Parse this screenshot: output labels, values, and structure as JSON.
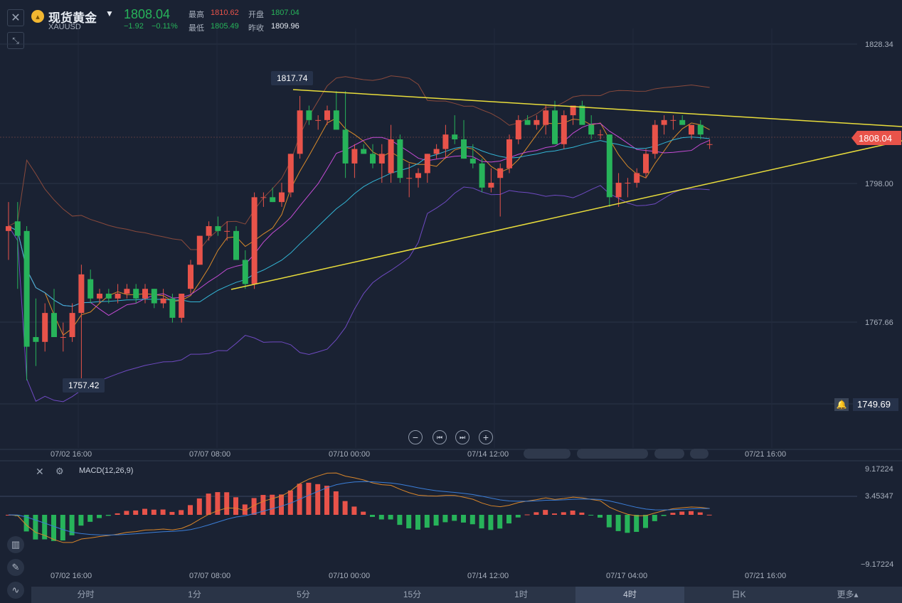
{
  "header": {
    "title": "现货黄金",
    "symbol": "XAUUSD",
    "price": "1808.04",
    "change": "−1.92",
    "change_pct": "−0.11%",
    "high_label": "最高",
    "high_value": "1810.62",
    "open_label": "开盘",
    "open_value": "1807.04",
    "low_label": "最低",
    "low_value": "1805.49",
    "prev_label": "昨收",
    "prev_value": "1809.96"
  },
  "price_axis": {
    "ticks": [
      "1828.34",
      "1798.00",
      "1767.66"
    ],
    "current_price": "1808.04",
    "alert_price": "1749.69"
  },
  "annotations": {
    "high": "1817.74",
    "low": "1757.42"
  },
  "time_axis": [
    "07/02 16:00",
    "07/07 08:00",
    "07/10 00:00",
    "07/14 12:00",
    "07/17 04:00",
    "07/21 16:00"
  ],
  "macd": {
    "label": "MACD(12,26,9)",
    "ticks": [
      "9.17224",
      "3.45347",
      "−9.17224"
    ]
  },
  "tabs": [
    "分时",
    "1分",
    "5分",
    "15分",
    "1时",
    "4时",
    "日K",
    "更多▴"
  ],
  "active_tab": "4时",
  "colors": {
    "up": "#e8534a",
    "down": "#27b35a",
    "trend": "#e9dd3b",
    "bg": "#1a2233"
  },
  "chart_data": {
    "type": "candlestick",
    "ylim": [
      1745,
      1832
    ],
    "candles": [
      [
        1790,
        1796,
        1784,
        1791
      ],
      [
        1792,
        1796,
        1778,
        1789
      ],
      [
        1790,
        1791,
        1759,
        1766
      ],
      [
        1768,
        1776,
        1762,
        1767
      ],
      [
        1767,
        1775,
        1765,
        1773
      ],
      [
        1773,
        1778,
        1768,
        1768
      ],
      [
        1768,
        1771,
        1765,
        1768
      ],
      [
        1768,
        1775,
        1767,
        1773
      ],
      [
        1773,
        1783,
        1758,
        1781
      ],
      [
        1780,
        1782,
        1775,
        1776
      ],
      [
        1776,
        1778,
        1775,
        1777
      ],
      [
        1777,
        1778,
        1775,
        1776
      ],
      [
        1776,
        1779,
        1775,
        1777
      ],
      [
        1777,
        1779,
        1776,
        1778
      ],
      [
        1778,
        1779,
        1775,
        1776
      ],
      [
        1776,
        1779,
        1775,
        1778
      ],
      [
        1778,
        1778,
        1774,
        1775
      ],
      [
        1775,
        1778,
        1774,
        1776
      ],
      [
        1776,
        1777,
        1771,
        1772
      ],
      [
        1772,
        1777,
        1771,
        1777
      ],
      [
        1778,
        1784,
        1777,
        1783
      ],
      [
        1783,
        1789,
        1783,
        1789
      ],
      [
        1789,
        1792,
        1788,
        1791
      ],
      [
        1791,
        1793,
        1789,
        1790
      ],
      [
        1790,
        1792,
        1788,
        1790
      ],
      [
        1790,
        1791,
        1784,
        1784
      ],
      [
        1784,
        1786,
        1778,
        1779
      ],
      [
        1779,
        1798,
        1778,
        1797
      ],
      [
        1797,
        1798,
        1795,
        1797
      ],
      [
        1797,
        1799,
        1796,
        1796
      ],
      [
        1796,
        1800,
        1795,
        1798
      ],
      [
        1798,
        1806,
        1797,
        1806
      ],
      [
        1806,
        1818,
        1805,
        1815
      ],
      [
        1815,
        1816,
        1812,
        1813
      ],
      [
        1813,
        1814,
        1811,
        1813
      ],
      [
        1813,
        1816,
        1812,
        1815
      ],
      [
        1815,
        1819,
        1813,
        1811
      ],
      [
        1811,
        1819,
        1801,
        1804
      ],
      [
        1804,
        1808,
        1801,
        1807
      ],
      [
        1807,
        1808,
        1806,
        1806
      ],
      [
        1806,
        1808,
        1803,
        1804
      ],
      [
        1804,
        1808,
        1800,
        1806
      ],
      [
        1802,
        1812,
        1800,
        1809
      ],
      [
        1809,
        1810,
        1800,
        1801
      ],
      [
        1801,
        1804,
        1797,
        1801
      ],
      [
        1801,
        1803,
        1799,
        1802
      ],
      [
        1802,
        1806,
        1800,
        1806
      ],
      [
        1806,
        1808,
        1805,
        1807
      ],
      [
        1807,
        1812,
        1805,
        1810
      ],
      [
        1810,
        1814,
        1808,
        1809
      ],
      [
        1809,
        1813,
        1805,
        1805
      ],
      [
        1805,
        1808,
        1803,
        1804
      ],
      [
        1804,
        1805,
        1798,
        1799
      ],
      [
        1799,
        1803,
        1798,
        1800
      ],
      [
        1801,
        1804,
        1793,
        1803
      ],
      [
        1803,
        1810,
        1802,
        1809
      ],
      [
        1809,
        1814,
        1808,
        1813
      ],
      [
        1813,
        1814,
        1812,
        1812
      ],
      [
        1812,
        1814,
        1811,
        1813
      ],
      [
        1812,
        1816,
        1810,
        1815
      ],
      [
        1815,
        1817,
        1808,
        1808
      ],
      [
        1808,
        1815,
        1807,
        1814
      ],
      [
        1814,
        1816,
        1812,
        1816
      ],
      [
        1816,
        1817,
        1813,
        1812
      ],
      [
        1812,
        1814,
        1809,
        1810
      ],
      [
        1810,
        1811,
        1809,
        1810
      ],
      [
        1810,
        1810,
        1795,
        1797
      ],
      [
        1797,
        1802,
        1795,
        1800
      ],
      [
        1800,
        1801,
        1797,
        1800
      ],
      [
        1800,
        1803,
        1799,
        1802
      ],
      [
        1802,
        1807,
        1801,
        1806
      ],
      [
        1806,
        1813,
        1805,
        1812
      ],
      [
        1812,
        1814,
        1810,
        1813
      ],
      [
        1813,
        1814,
        1811,
        1813
      ],
      [
        1813,
        1814,
        1812,
        1812
      ],
      [
        1810,
        1812,
        1809,
        1812
      ],
      [
        1812,
        1813,
        1809,
        1810
      ],
      [
        1808,
        1809,
        1807,
        1808
      ]
    ],
    "trendlines": [
      {
        "from": [
          325,
          407
        ],
        "to": [
          1268,
          198
        ]
      },
      {
        "from": [
          412,
          126
        ],
        "to": [
          1268,
          178
        ]
      }
    ]
  }
}
